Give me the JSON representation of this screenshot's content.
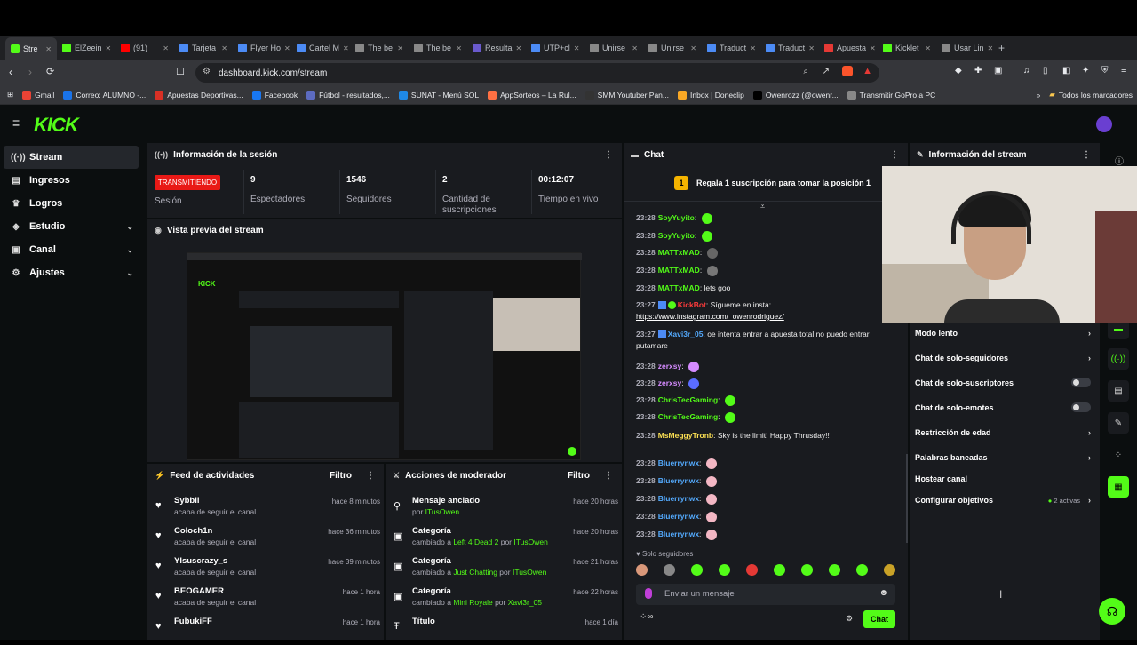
{
  "browser": {
    "tabs": [
      {
        "label": "Stre",
        "color": "#53fc18",
        "active": true
      },
      {
        "label": "ElZeein",
        "color": "#53fc18"
      },
      {
        "label": "(91)",
        "color": "#ff0000"
      },
      {
        "label": "Tarjeta",
        "color": "#4c8bf5"
      },
      {
        "label": "Flyer Ho",
        "color": "#4c8bf5"
      },
      {
        "label": "Cartel M",
        "color": "#4c8bf5"
      },
      {
        "label": "The be",
        "color": "#888888"
      },
      {
        "label": "The be",
        "color": "#888888"
      },
      {
        "label": "Resulta",
        "color": "#6a5acd"
      },
      {
        "label": "UTP+cl",
        "color": "#4c8bf5"
      },
      {
        "label": "Unirse",
        "color": "#888888"
      },
      {
        "label": "Unirse",
        "color": "#888888"
      },
      {
        "label": "Traduct",
        "color": "#4c8bf5"
      },
      {
        "label": "Traduct",
        "color": "#4c8bf5"
      },
      {
        "label": "Apuesta",
        "color": "#e53935"
      },
      {
        "label": "Kicklet",
        "color": "#53fc18"
      },
      {
        "label": "Usar Lin",
        "color": "#888888"
      }
    ],
    "url": "dashboard.kick.com/stream",
    "bookmarks": [
      "Gmail",
      "Correo: ALUMNO -...",
      "Apuestas Deportivas...",
      "Facebook",
      "Fútbol - resultados,...",
      "SUNAT - Menú SOL",
      "AppSorteos – La Rul...",
      "SMM Youtuber Pan...",
      "Inbox | Doneclip",
      "Owenrozz (@owenr...",
      "Transmitir GoPro a PC"
    ],
    "all_bookmarks": "Todos los marcadores"
  },
  "kick": {
    "brand_color": "#53fc18",
    "logo_text": "KICK",
    "sidebar": [
      {
        "label": "Stream",
        "icon": "broadcast-icon",
        "active": true
      },
      {
        "label": "Ingresos",
        "icon": "money-icon"
      },
      {
        "label": "Logros",
        "icon": "trophy-icon"
      },
      {
        "label": "Estudio",
        "icon": "layers-icon",
        "chevron": true
      },
      {
        "label": "Canal",
        "icon": "channel-icon",
        "chevron": true
      },
      {
        "label": "Ajustes",
        "icon": "gear-icon",
        "chevron": true
      }
    ]
  },
  "session": {
    "title": "Información de la sesión",
    "live_badge": "TRANSMITIENDO",
    "session_label": "Sesión",
    "stats": [
      {
        "value": "9",
        "label": "Espectadores"
      },
      {
        "value": "1546",
        "label": "Seguidores"
      },
      {
        "value": "2",
        "label": "Cantidad de suscripciones"
      },
      {
        "value": "00:12:07",
        "label": "Tiempo en vivo"
      }
    ]
  },
  "preview": {
    "title": "Vista previa del stream"
  },
  "feed": {
    "title": "Feed de actividades",
    "filter": "Filtro",
    "items": [
      {
        "name": "Sybbil",
        "sub": "acaba de seguir el canal",
        "time": "hace 8 minutos"
      },
      {
        "name": "Coloch1n",
        "sub": "acaba de seguir el canal",
        "time": "hace 36 minutos"
      },
      {
        "name": "Ylsuscrazy_s",
        "sub": "acaba de seguir el canal",
        "time": "hace 39 minutos"
      },
      {
        "name": "BEOGAMER",
        "sub": "acaba de seguir el canal",
        "time": "hace 1 hora"
      },
      {
        "name": "FubukiFF",
        "sub": "",
        "time": "hace 1 hora"
      }
    ]
  },
  "modactions": {
    "title": "Acciones de moderador",
    "filter": "Filtro",
    "items": [
      {
        "name": "Mensaje anclado",
        "pre": "por ",
        "hl": "ITusOwen",
        "mid": "",
        "hl2": "",
        "time": "hace 20 horas"
      },
      {
        "name": "Categoría",
        "pre": "cambiado a ",
        "hl": "Left 4 Dead 2",
        "mid": " por ",
        "hl2": "ITusOwen",
        "time": "hace 20 horas"
      },
      {
        "name": "Categoría",
        "pre": "cambiado a ",
        "hl": "Just Chatting",
        "mid": " por ",
        "hl2": "ITusOwen",
        "time": "hace 21 horas"
      },
      {
        "name": "Categoría",
        "pre": "cambiado a ",
        "hl": "Mini Royale",
        "mid": " por ",
        "hl2": "Xavi3r_05",
        "time": "hace 22 horas"
      },
      {
        "name": "Título",
        "pre": "",
        "hl": "",
        "mid": "",
        "hl2": "",
        "time": "hace 1 día"
      }
    ]
  },
  "chat": {
    "title": "Chat",
    "pinned": "Regala 1 suscripción para tomar la posición 1",
    "messages": [
      {
        "time": "23:28",
        "user": "SoyYuyito",
        "color": "#53fc18",
        "text": ""
      },
      {
        "time": "23:28",
        "user": "SoyYuyito",
        "color": "#53fc18",
        "text": ""
      },
      {
        "time": "23:28",
        "user": "MATTxMAD",
        "color": "#53fc18",
        "text": ""
      },
      {
        "time": "23:28",
        "user": "MATTxMAD",
        "color": "#53fc18",
        "text": ""
      },
      {
        "time": "23:28",
        "user": "MATTxMAD",
        "color": "#53fc18",
        "text": "lets goo"
      },
      {
        "time": "23:27",
        "user": "KickBot",
        "color": "#ff3b3b",
        "text": "Sígueme en insta:",
        "link": "https://www.instagram.com/_owenrodriguez/"
      },
      {
        "time": "23:27",
        "user": "Xavi3r_05",
        "color": "#53a9fc",
        "text": "oe intenta entrar a apuesta total no puedo entrar putamare"
      },
      {
        "time": "23:28",
        "user": "zerxsy",
        "color": "#d58bff",
        "text": ""
      },
      {
        "time": "23:28",
        "user": "zerxsy",
        "color": "#d58bff",
        "text": ""
      },
      {
        "time": "23:28",
        "user": "ChrisTecGaming",
        "color": "#53fc18",
        "text": ""
      },
      {
        "time": "23:28",
        "user": "ChrisTecGaming",
        "color": "#53fc18",
        "text": ""
      },
      {
        "time": "23:28",
        "user": "MsMeggyTronb",
        "color": "#fce053",
        "text": "Sky is the limit! Happy Thrusday!!"
      },
      {
        "time": "23:28",
        "user": "Bluerrynwx",
        "color": "#53a9fc",
        "text": ""
      },
      {
        "time": "23:28",
        "user": "Bluerrynwx",
        "color": "#53a9fc",
        "text": ""
      },
      {
        "time": "23:28",
        "user": "Bluerrynwx",
        "color": "#53a9fc",
        "text": ""
      },
      {
        "time": "23:28",
        "user": "Bluerrynwx",
        "color": "#53a9fc",
        "text": ""
      },
      {
        "time": "23:28",
        "user": "Bluerrynwx",
        "color": "#53a9fc",
        "text": ""
      }
    ],
    "followers_only": "Solo seguidores",
    "input_placeholder": "Enviar un mensaje",
    "send_label": "Chat"
  },
  "streaminfo": {
    "title": "Información del stream",
    "settings": [
      {
        "label": "Modo lento",
        "ctrl": "chevron"
      },
      {
        "label": "Chat de solo-seguidores",
        "ctrl": "chevron"
      },
      {
        "label": "Chat de solo-suscriptores",
        "ctrl": "toggle"
      },
      {
        "label": "Chat de solo-emotes",
        "ctrl": "toggle"
      },
      {
        "label": "Restricción de edad",
        "ctrl": "chevron"
      },
      {
        "label": "Palabras baneadas",
        "ctrl": "chevron"
      },
      {
        "label": "Hostear canal",
        "ctrl": "none"
      },
      {
        "label": "Configurar objetivos",
        "ctrl": "chevron",
        "badge": "2 activas"
      }
    ]
  }
}
